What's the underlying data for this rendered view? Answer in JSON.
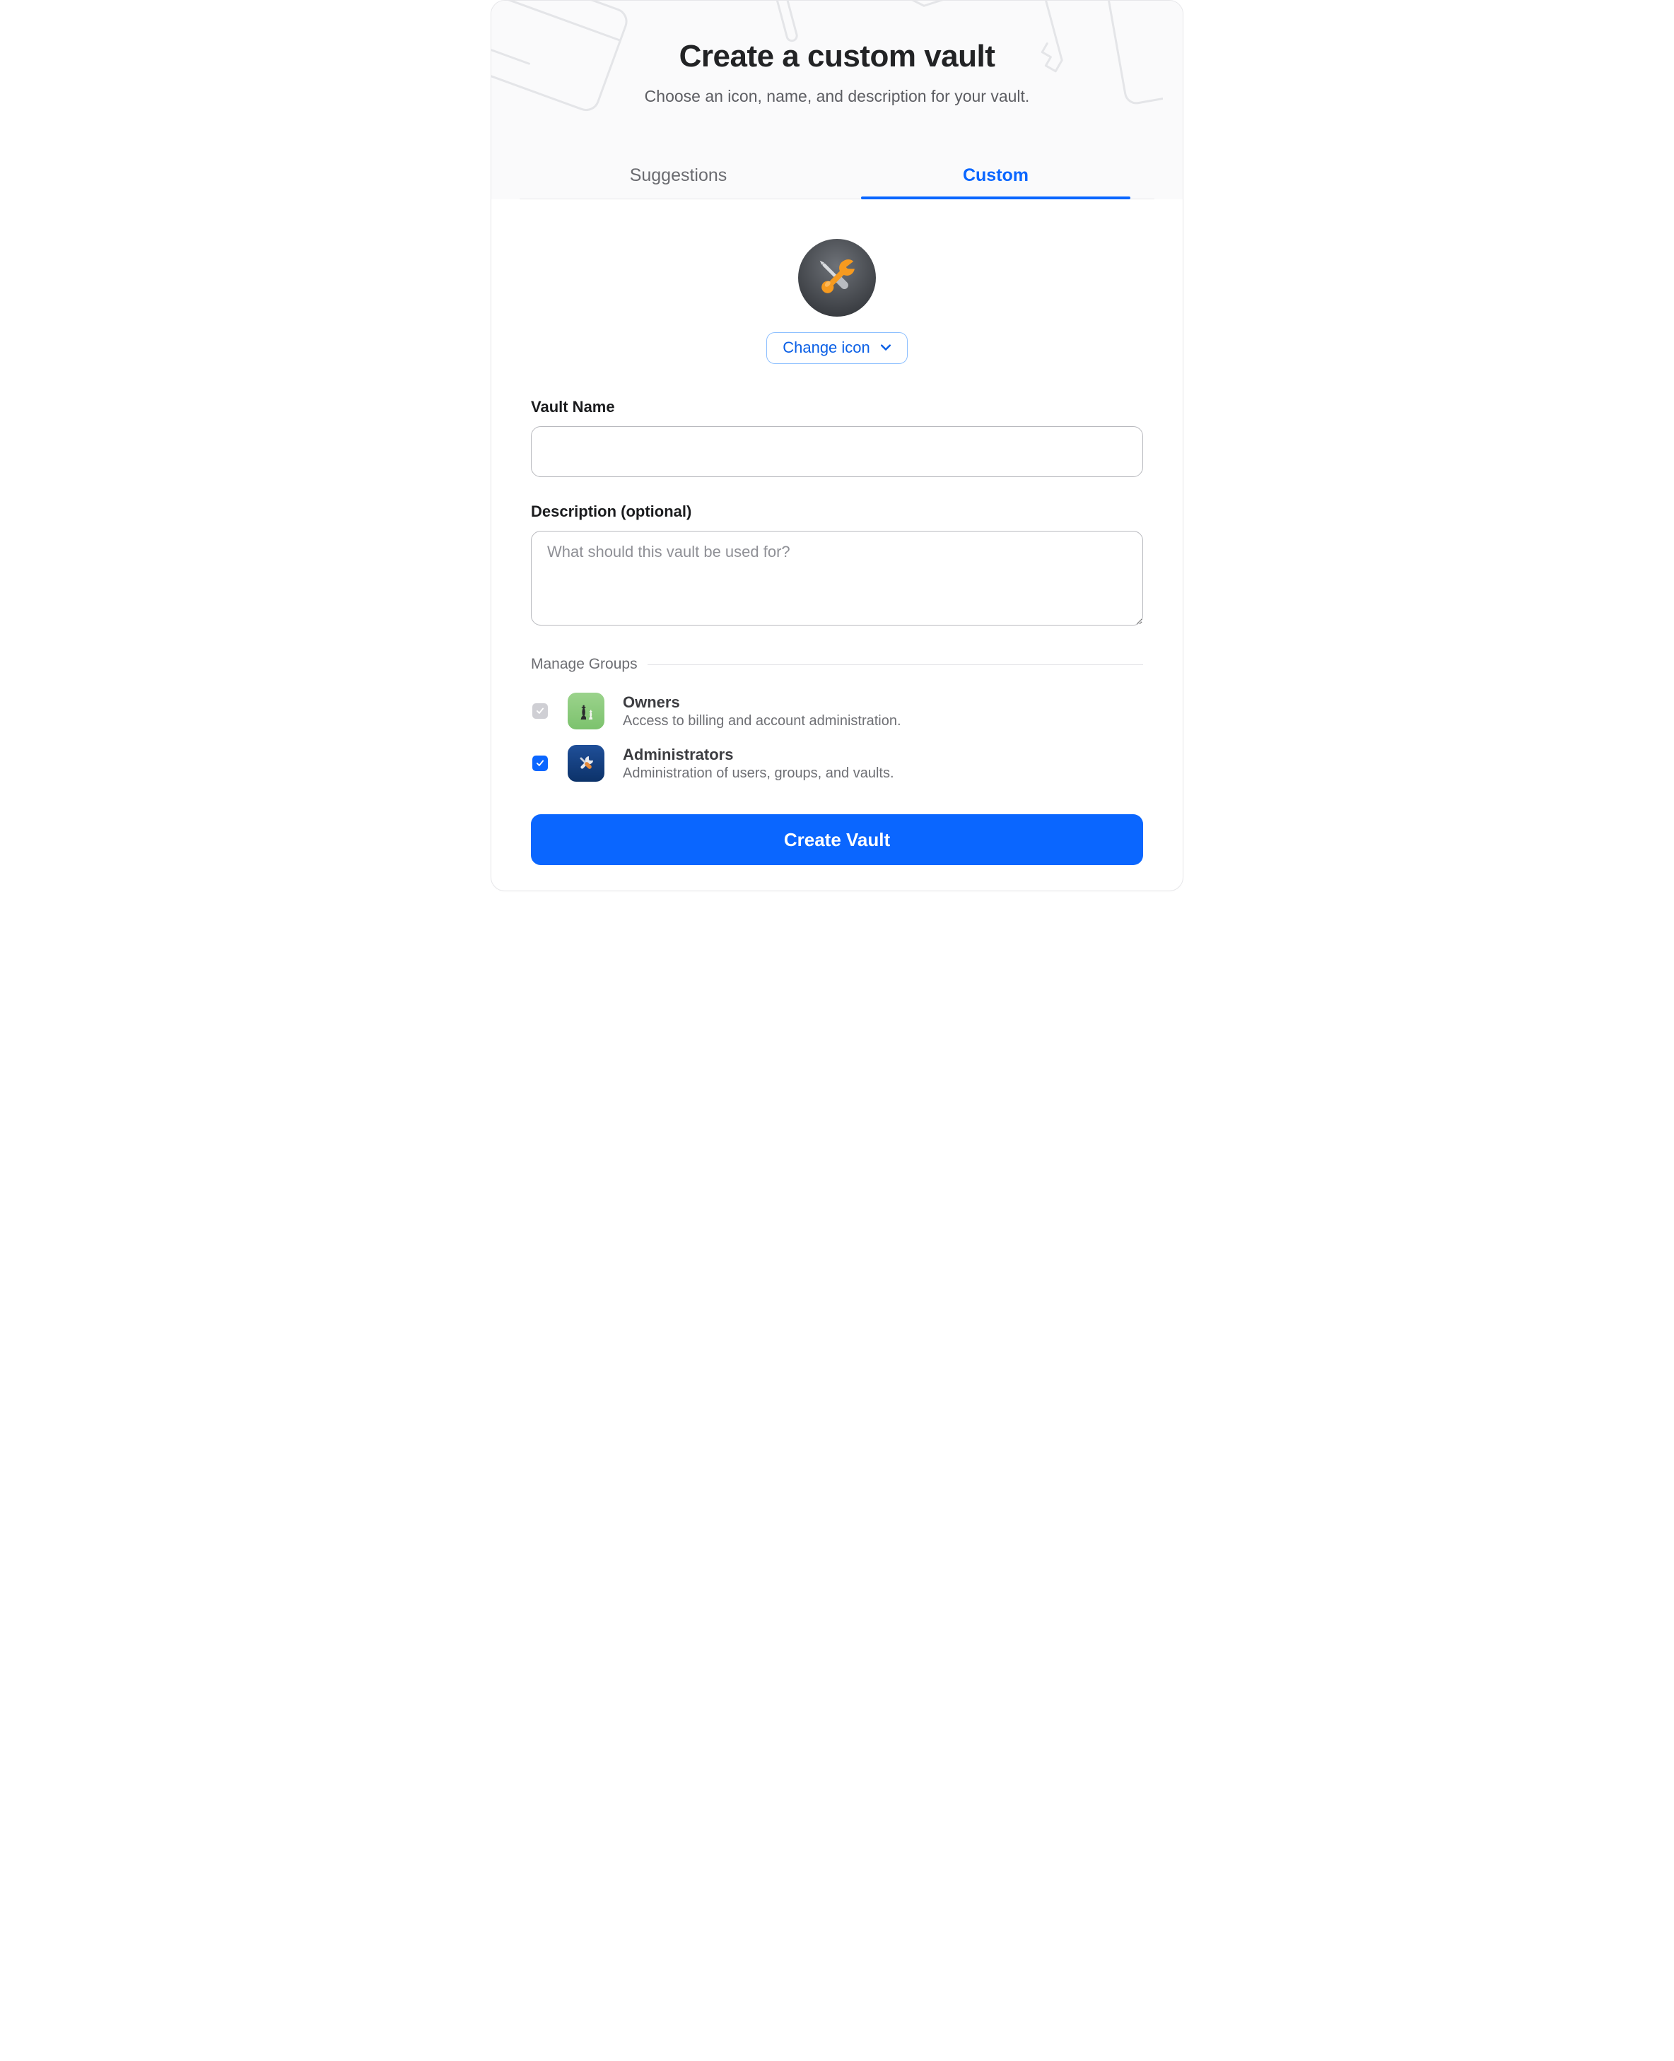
{
  "header": {
    "title": "Create a custom vault",
    "subtitle": "Choose an icon, name, and description for your vault."
  },
  "tabs": {
    "suggestions": "Suggestions",
    "custom": "Custom",
    "active": "custom"
  },
  "icon": {
    "kind": "tools-icon",
    "change_label": "Change icon"
  },
  "form": {
    "name_label": "Vault Name",
    "name_value": "",
    "description_label": "Description (optional)",
    "description_value": "",
    "description_placeholder": "What should this vault be used for?"
  },
  "groups": {
    "legend": "Manage Groups",
    "items": [
      {
        "id": "owners",
        "title": "Owners",
        "desc": "Access to billing and account administration.",
        "checked": true,
        "locked": true,
        "icon": "chess-icon"
      },
      {
        "id": "administrators",
        "title": "Administrators",
        "desc": "Administration of users, groups, and vaults.",
        "checked": true,
        "locked": false,
        "icon": "wrench-cross-icon"
      }
    ]
  },
  "cta": {
    "label": "Create Vault"
  },
  "colors": {
    "accent": "#0a66ff",
    "muted_text": "#6a6b70",
    "border": "#e6e6e9"
  }
}
